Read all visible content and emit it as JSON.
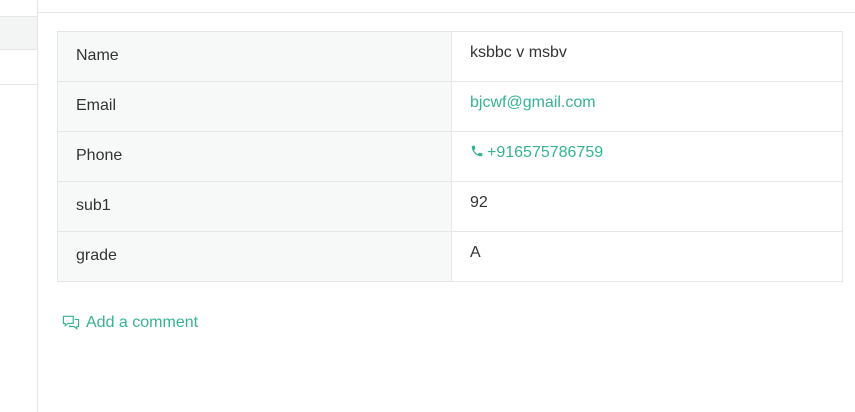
{
  "details": {
    "rows": [
      {
        "label": "Name",
        "value": "ksbbc v msbv"
      },
      {
        "label": "Email",
        "value": "bjcwf@gmail.com"
      },
      {
        "label": "Phone",
        "value": "+916575786759"
      },
      {
        "label": "sub1",
        "value": "92"
      },
      {
        "label": "grade",
        "value": "A"
      }
    ]
  },
  "comment": {
    "label": "Add a comment"
  },
  "colors": {
    "accent": "#36b394",
    "label_bg": "#f7f8f8",
    "border": "#e5e7e7"
  },
  "icons": {
    "phone": "phone-icon",
    "comment": "comment-icon"
  }
}
